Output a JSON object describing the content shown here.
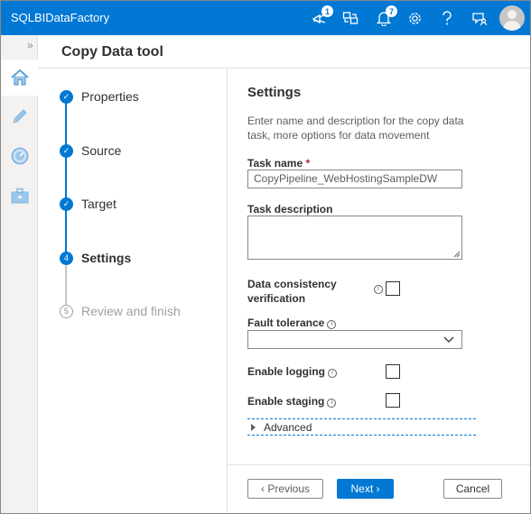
{
  "app": {
    "title": "SQLBIDataFactory"
  },
  "topbar": {
    "icons": [
      {
        "name": "notifications-feedback-icon",
        "badge": "1"
      },
      {
        "name": "directory-switch-icon",
        "badge": ""
      },
      {
        "name": "bell-icon",
        "badge": "7"
      },
      {
        "name": "gear-icon",
        "badge": ""
      },
      {
        "name": "help-icon",
        "badge": ""
      },
      {
        "name": "feedback-icon",
        "badge": ""
      }
    ],
    "accent_color": "#0078d4"
  },
  "rail": {
    "items": [
      {
        "icon": "home-icon",
        "active": true
      },
      {
        "icon": "pencil-icon",
        "active": false
      },
      {
        "icon": "monitor-gauge-icon",
        "active": false
      },
      {
        "icon": "toolbox-icon",
        "active": false
      }
    ]
  },
  "tool": {
    "title": "Copy Data tool"
  },
  "steps": [
    {
      "label": "Properties",
      "state": "done",
      "number": ""
    },
    {
      "label": "Source",
      "state": "done",
      "number": ""
    },
    {
      "label": "Target",
      "state": "done",
      "number": ""
    },
    {
      "label": "Settings",
      "state": "current",
      "number": "4"
    },
    {
      "label": "Review and finish",
      "state": "pending",
      "number": "5"
    }
  ],
  "settings": {
    "title": "Settings",
    "description": "Enter name and description for the copy data task, more options for data movement",
    "task_name_label": "Task name",
    "required_marker": "*",
    "task_name_value": "CopyPipeline_WebHostingSampleDW",
    "task_description_label": "Task description",
    "task_description_value": "",
    "data_consistency_label": "Data consistency verification",
    "data_consistency_checked": false,
    "fault_tolerance_label": "Fault tolerance",
    "fault_tolerance_value": "",
    "enable_logging_label": "Enable logging",
    "enable_logging_checked": false,
    "enable_staging_label": "Enable staging",
    "enable_staging_checked": false,
    "advanced_label": "Advanced"
  },
  "footer": {
    "previous_label": "Previous",
    "next_label": "Next",
    "cancel_label": "Cancel"
  }
}
